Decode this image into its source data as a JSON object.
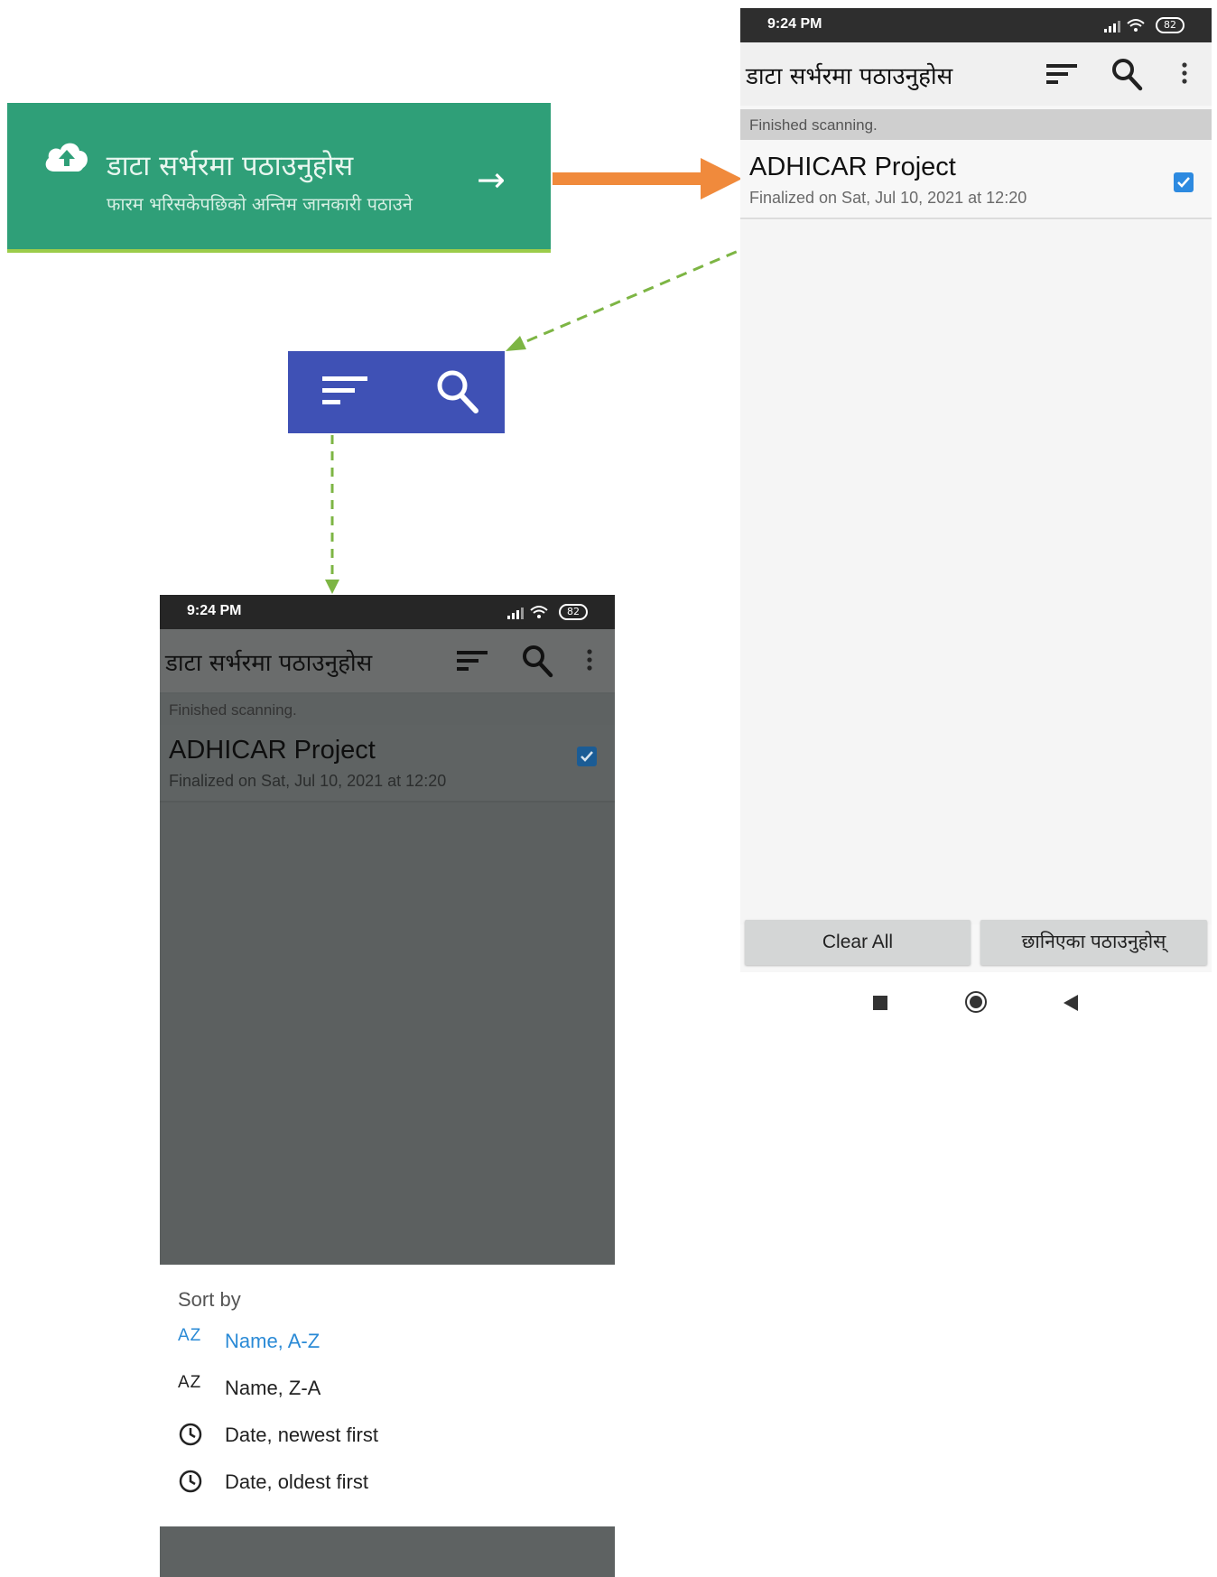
{
  "banner": {
    "title": "डाटा सर्भरमा पठाउनुहोस",
    "subtitle": "फारम भरिसकेपछिको अन्तिम जानकारी पठाउने",
    "arrow": "→",
    "bg_color": "#2f9f78"
  },
  "zoom_toolbar": {
    "bg_color": "#3f51b5",
    "icons": [
      "sort-icon",
      "search-icon"
    ]
  },
  "phone_right": {
    "status_time": "9:24 PM",
    "battery": "82",
    "app_title": "डाटा सर्भरमा पठाउनुहोस",
    "section_header": "Finished scanning.",
    "item": {
      "name": "ADHICAR Project",
      "date": "Finalized on Sat, Jul 10, 2021 at 12:20",
      "checked": true
    },
    "buttons": {
      "clear_all": "Clear All",
      "send_selected": "छानिएका पठाउनुहोस्"
    },
    "nav_icons": [
      "recents-icon",
      "home-icon",
      "back-icon"
    ]
  },
  "phone_left": {
    "status_time": "9:24 PM",
    "battery": "82",
    "app_title": "डाटा सर्भरमा पठाउनुहोस",
    "section_header": "Finished scanning.",
    "item": {
      "name": "ADHICAR Project",
      "date": "Finalized on Sat, Jul 10, 2021 at 12:20",
      "checked": true
    },
    "sort_sheet": {
      "header": "Sort by",
      "options": [
        {
          "label": "Name, A-Z",
          "icon": "AZ",
          "selected": true
        },
        {
          "label": "Name, Z-A",
          "icon": "AZ",
          "selected": false
        },
        {
          "label": "Date, newest first",
          "icon": "clock-icon",
          "selected": false
        },
        {
          "label": "Date, oldest first",
          "icon": "clock-icon",
          "selected": false
        }
      ],
      "accent_color": "#2a8ad6"
    }
  },
  "annotation_colors": {
    "orange_arrow": "#f08a3c",
    "green_dashed": "#7db544"
  }
}
